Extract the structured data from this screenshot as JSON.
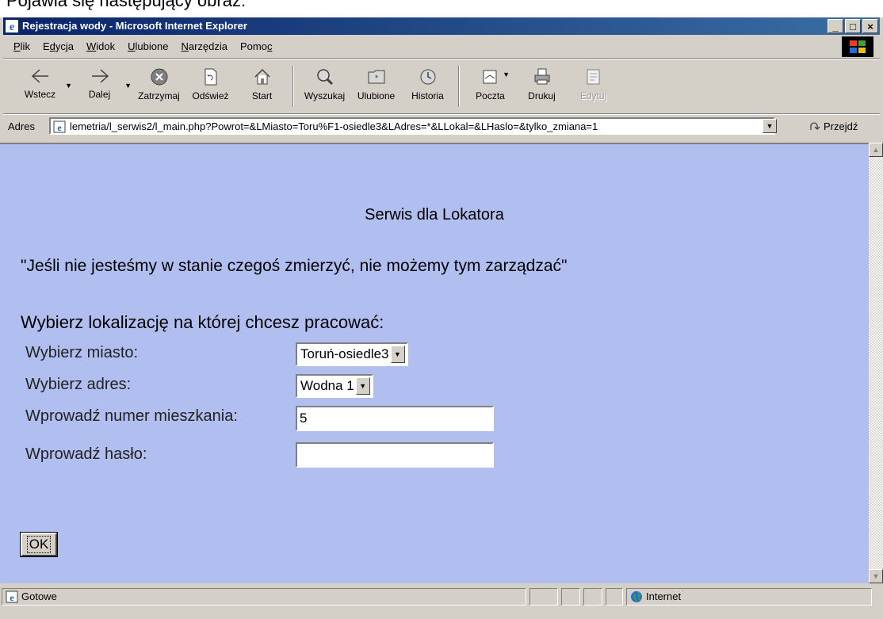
{
  "caption": "Pojawia się następujący obraz:",
  "window": {
    "title": "Rejestracja wody - Microsoft Internet Explorer",
    "controls": [
      "_",
      "□",
      "×"
    ]
  },
  "menu": [
    {
      "pre": "",
      "u": "P",
      "post": "lik"
    },
    {
      "pre": "E",
      "u": "d",
      "post": "ycja"
    },
    {
      "pre": "",
      "u": "W",
      "post": "idok"
    },
    {
      "pre": "",
      "u": "U",
      "post": "lubione"
    },
    {
      "pre": "",
      "u": "N",
      "post": "arzędzia"
    },
    {
      "pre": "Pomo",
      "u": "c",
      "post": ""
    }
  ],
  "toolbar": {
    "back": "Wstecz",
    "forward": "Dalej",
    "stop": "Zatrzymaj",
    "refresh": "Odśwież",
    "home": "Start",
    "search": "Wyszukaj",
    "favorites": "Ulubione",
    "history": "Historia",
    "mail": "Poczta",
    "print": "Drukuj",
    "edit": "Edytuj"
  },
  "address": {
    "label": "Adres",
    "url": "lemetria/l_serwis2/l_main.php?Powrot=&LMiasto=Toru%F1-osiedle3&LAdres=*&LLokal=&LHaslo=&tylko_zmiana=1",
    "go": "Przejdź"
  },
  "page": {
    "title": "Serwis dla Lokatora",
    "quote": "\"Jeśli nie jesteśmy w stanie czegoś zmierzyć, nie możemy tym zarządzać\"",
    "subtitle": "Wybierz lokalizację na której chcesz pracować:",
    "city_label": "Wybierz miasto:",
    "city_value": "Toruń-osiedle3",
    "address_label": "Wybierz adres:",
    "address_value": "Wodna 1",
    "flat_label": "Wprowadź numer mieszkania:",
    "flat_value": "5",
    "password_label": "Wprowadź hasło:",
    "password_value": "",
    "ok_label": "OK"
  },
  "status": {
    "text": "Gotowe",
    "zone": "Internet"
  },
  "colors": {
    "content_bg": "#b0bff0",
    "titlebar_start": "#0a246a",
    "titlebar_end": "#3a6ea5",
    "chrome": "#d4d0c8"
  }
}
